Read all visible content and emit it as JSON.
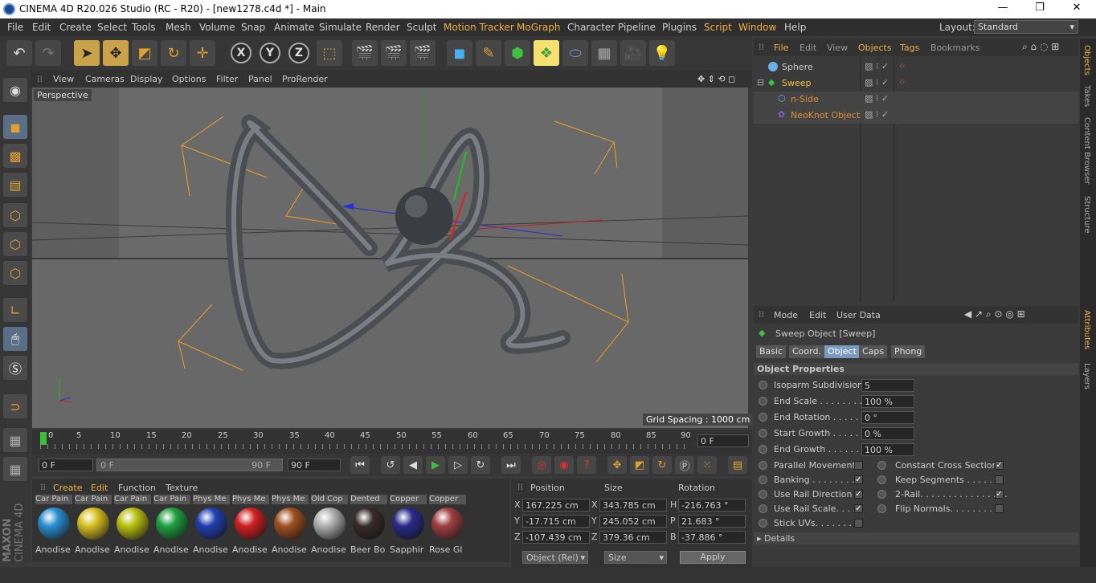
{
  "window": {
    "title": "CINEMA 4D R20.026 Studio (RC - R20) - [new1278.c4d *] - Main",
    "min": "—",
    "max": "❐",
    "close": "✕"
  },
  "menu": [
    "File",
    "Edit",
    "Create",
    "Select",
    "Tools",
    "Mesh",
    "Volume",
    "Snap",
    "Animate",
    "Simulate",
    "Render",
    "Sculpt",
    "Motion Tracker",
    "MoGraph",
    "Character",
    "Pipeline",
    "Plugins",
    "Script",
    "Window",
    "Help"
  ],
  "layout": {
    "label": "Layout:",
    "value": "Standard"
  },
  "viewport": {
    "menu": [
      "View",
      "Cameras",
      "Display",
      "Options",
      "Filter",
      "Panel",
      "ProRender"
    ],
    "label": "Perspective",
    "grid_spacing": "Grid Spacing : 1000 cm"
  },
  "timeline": {
    "ticks": [
      "0",
      "5",
      "10",
      "15",
      "20",
      "25",
      "30",
      "35",
      "40",
      "45",
      "50",
      "55",
      "60",
      "65",
      "70",
      "75",
      "80",
      "85",
      "90"
    ],
    "current": "0 F"
  },
  "playback": {
    "start": "0 F",
    "range_start": "0 F",
    "range_end": "90 F",
    "end": "90 F"
  },
  "materials": {
    "menu": [
      "Create",
      "Edit",
      "Function",
      "Texture"
    ],
    "items": [
      {
        "label": "Car Pain",
        "name": "Anodise",
        "color": "#2a8fd0"
      },
      {
        "label": "Car Pain",
        "name": "Anodise",
        "color": "#d8c020"
      },
      {
        "label": "Car Pain",
        "name": "Anodise",
        "color": "#b8c010"
      },
      {
        "label": "Car Pain",
        "name": "Anodise",
        "color": "#20a040"
      },
      {
        "label": "Phys Me",
        "name": "Anodise",
        "color": "#2040b0"
      },
      {
        "label": "Phys Me",
        "name": "Anodise",
        "color": "#d02020"
      },
      {
        "label": "Phys Me",
        "name": "Anodise",
        "color": "#a05020"
      },
      {
        "label": "Old Cop",
        "name": "Anodise",
        "color": "#b0b0b0"
      },
      {
        "label": "Dented",
        "name": "Beer Bo",
        "color": "#3a2a2a"
      },
      {
        "label": "Copper",
        "name": "Sapphir",
        "color": "#2a2a8a"
      },
      {
        "label": "Copper",
        "name": "Rose Gl",
        "color": "#a04040"
      }
    ]
  },
  "coords": {
    "headers": [
      "Position",
      "Size",
      "Rotation"
    ],
    "rows": [
      {
        "a": "X",
        "p": "167.225 cm",
        "sa": "X",
        "s": "343.785 cm",
        "ra": "H",
        "r": "-216.763 °"
      },
      {
        "a": "Y",
        "p": "-17.715 cm",
        "sa": "Y",
        "s": "245.052 cm",
        "ra": "P",
        "r": "21.683 °"
      },
      {
        "a": "Z",
        "p": "-107.439 cm",
        "sa": "Z",
        "s": "379.36 cm",
        "ra": "B",
        "r": "-37.886 °"
      }
    ],
    "mode": "Object (Rel)",
    "size_mode": "Size",
    "apply": "Apply"
  },
  "objects": {
    "menu": [
      "File",
      "Edit",
      "View",
      "Objects",
      "Tags",
      "Bookmarks"
    ],
    "items": [
      {
        "name": "Sphere",
        "color": "#c8c8c8"
      },
      {
        "name": "Sweep",
        "color": "#f0c040"
      },
      {
        "name": "n-Side",
        "color": "#e09030"
      },
      {
        "name": "NeoKnot Object",
        "color": "#e09030"
      }
    ]
  },
  "attributes": {
    "menu": [
      "Mode",
      "Edit",
      "User Data"
    ],
    "title": "Sweep Object [Sweep]",
    "tabs": [
      "Basic",
      "Coord.",
      "Object",
      "Caps",
      "Phong"
    ],
    "section": "Object Properties",
    "fields": [
      {
        "label": "Isoparm Subdivision",
        "value": "5"
      },
      {
        "label": "End Scale . . . . . . . . . .",
        "value": "100 %"
      },
      {
        "label": "End Rotation . . . . . .",
        "value": "0 °"
      },
      {
        "label": "Start Growth . . . . . .",
        "value": "0 %"
      },
      {
        "label": "End Growth . . . . . . .",
        "value": "100 %"
      }
    ],
    "checks_left": [
      {
        "label": "Parallel Movement",
        "checked": false
      },
      {
        "label": "Banking . . . . . . . . .",
        "checked": true
      },
      {
        "label": "Use Rail Direction",
        "checked": true
      },
      {
        "label": "Use Rail Scale. . . . .",
        "checked": true
      },
      {
        "label": "Stick UVs. . . . . . . .",
        "checked": false
      }
    ],
    "checks_right": [
      {
        "label": "Constant Cross Section",
        "checked": true
      },
      {
        "label": "Keep Segments . . . . . . .",
        "checked": false
      },
      {
        "label": "2-Rail. . . . . . . . . . . . . . . .",
        "checked": true
      },
      {
        "label": "Flip Normals. . . . . . . . .",
        "checked": false
      }
    ],
    "details": "Details"
  },
  "right_tabs": [
    "Objects",
    "Takes",
    "Content Browser",
    "Structure",
    "Attributes",
    "Layers"
  ],
  "brand": [
    "MAXON",
    "CINEMA 4D"
  ]
}
